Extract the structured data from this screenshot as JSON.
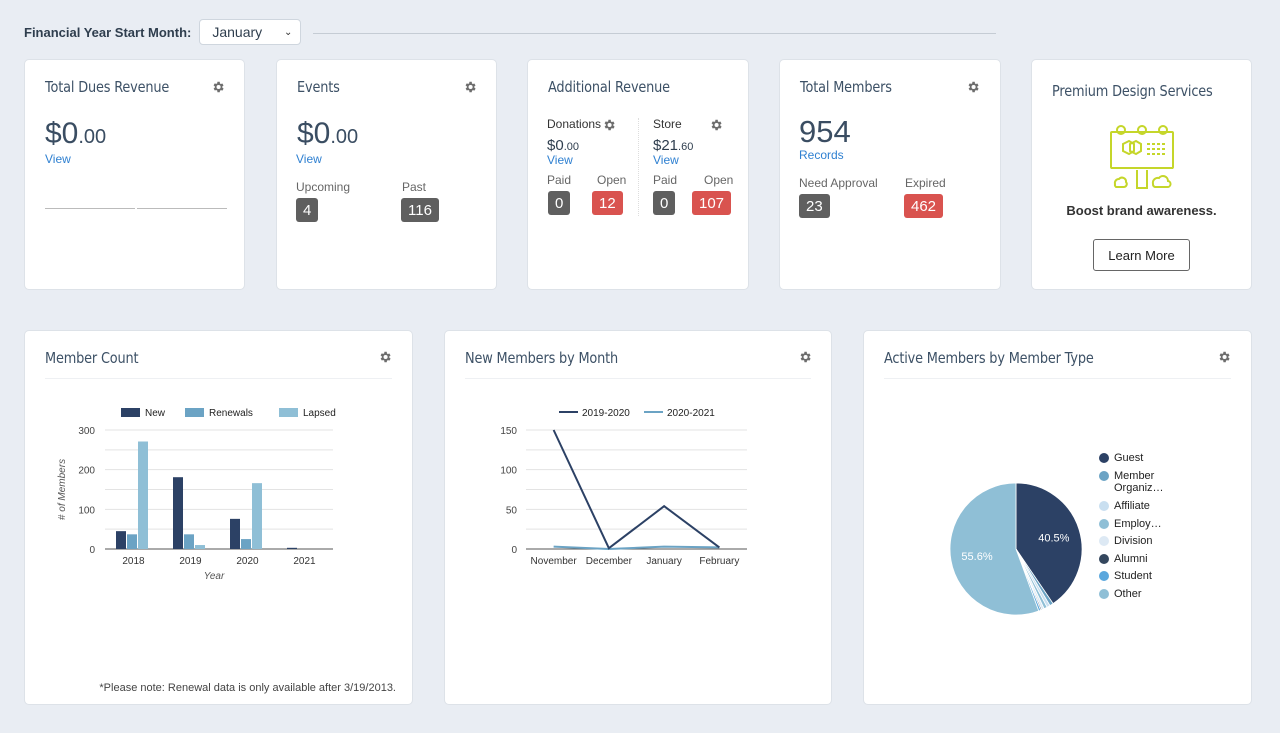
{
  "filter": {
    "label": "Financial Year Start Month:",
    "selected": "January"
  },
  "cards": {
    "dues": {
      "title": "Total Dues Revenue",
      "amount_whole": "$0",
      "amount_cents": ".00",
      "link": "View"
    },
    "events": {
      "title": "Events",
      "amount_whole": "$0",
      "amount_cents": ".00",
      "link": "View",
      "upcoming_label": "Upcoming",
      "upcoming_value": "4",
      "past_label": "Past",
      "past_value": "116"
    },
    "additional": {
      "title": "Additional Revenue",
      "donations": {
        "label": "Donations",
        "amount_whole": "$0",
        "amount_cents": ".00",
        "link": "View",
        "paid_label": "Paid",
        "paid_value": "0",
        "open_label": "Open",
        "open_value": "12"
      },
      "store": {
        "label": "Store",
        "amount_whole": "$21",
        "amount_cents": ".60",
        "link": "View",
        "paid_label": "Paid",
        "paid_value": "0",
        "open_label": "Open",
        "open_value": "107"
      }
    },
    "members": {
      "title": "Total Members",
      "count": "954",
      "link": "Records",
      "approval_label": "Need Approval",
      "approval_value": "23",
      "expired_label": "Expired",
      "expired_value": "462"
    },
    "premium": {
      "title": "Premium Design Services",
      "tagline": "Boost brand awareness.",
      "button": "Learn More",
      "icon_color": "#c5d62a"
    }
  },
  "panels": {
    "member_count": {
      "title": "Member Count",
      "note": "*Please note: Renewal data is only available after 3/19/2013."
    },
    "new_members": {
      "title": "New Members by Month"
    },
    "member_type": {
      "title": "Active Members by Member Type"
    }
  },
  "colors": {
    "navy": "#2c4165",
    "mid": "#6ba3c4",
    "light": "#8fbfd6",
    "red": "#d9534f",
    "gray": "#5f5f5f",
    "link": "#2f80d1"
  },
  "chart_data": [
    {
      "type": "bar",
      "title": "Member Count",
      "xlabel": "Year",
      "ylabel": "# of Members",
      "categories": [
        "2018",
        "2019",
        "2020",
        "2021"
      ],
      "series": [
        {
          "name": "New",
          "color": "#2c4165",
          "values": [
            45,
            181,
            76,
            3
          ]
        },
        {
          "name": "Renewals",
          "color": "#6ba3c4",
          "values": [
            37,
            37,
            25,
            0
          ]
        },
        {
          "name": "Lapsed",
          "color": "#8fbfd6",
          "values": [
            271,
            10,
            166,
            0
          ]
        }
      ],
      "ylim": [
        0,
        300
      ],
      "yticks": [
        0,
        100,
        200,
        300
      ],
      "grid": true,
      "legend": "top"
    },
    {
      "type": "line",
      "title": "New Members by Month",
      "categories": [
        "November",
        "December",
        "January",
        "February"
      ],
      "series": [
        {
          "name": "2019-2020",
          "color": "#2c4165",
          "values": [
            150,
            1,
            54,
            2
          ]
        },
        {
          "name": "2020-2021",
          "color": "#6ba3c4",
          "values": [
            3,
            0,
            3,
            2
          ]
        }
      ],
      "ylim": [
        0,
        150
      ],
      "yticks": [
        0,
        50,
        100,
        150
      ],
      "grid": true,
      "legend": "top"
    },
    {
      "type": "pie",
      "title": "Active Members by Member Type",
      "slices": [
        {
          "name": "Guest",
          "value": 40.5,
          "color": "#2c4165",
          "label": "40.5%"
        },
        {
          "name": "Member Organiz…",
          "value": 0.9,
          "color": "#6ba3c4",
          "label": ""
        },
        {
          "name": "Affiliate",
          "value": 0.8,
          "color": "#c9dff0",
          "label": ""
        },
        {
          "name": "Employ…",
          "value": 0.8,
          "color": "#8fbfd6",
          "label": ""
        },
        {
          "name": "Division",
          "value": 0.6,
          "color": "#dde9f4",
          "label": ""
        },
        {
          "name": "Alumni",
          "value": 0.3,
          "color": "#34475e",
          "label": ""
        },
        {
          "name": "Student",
          "value": 0.5,
          "color": "#5aa7dd",
          "label": ""
        },
        {
          "name": "Other",
          "value": 55.6,
          "color": "#8fbfd6",
          "label": "55.6%"
        }
      ],
      "legend": "right"
    }
  ]
}
